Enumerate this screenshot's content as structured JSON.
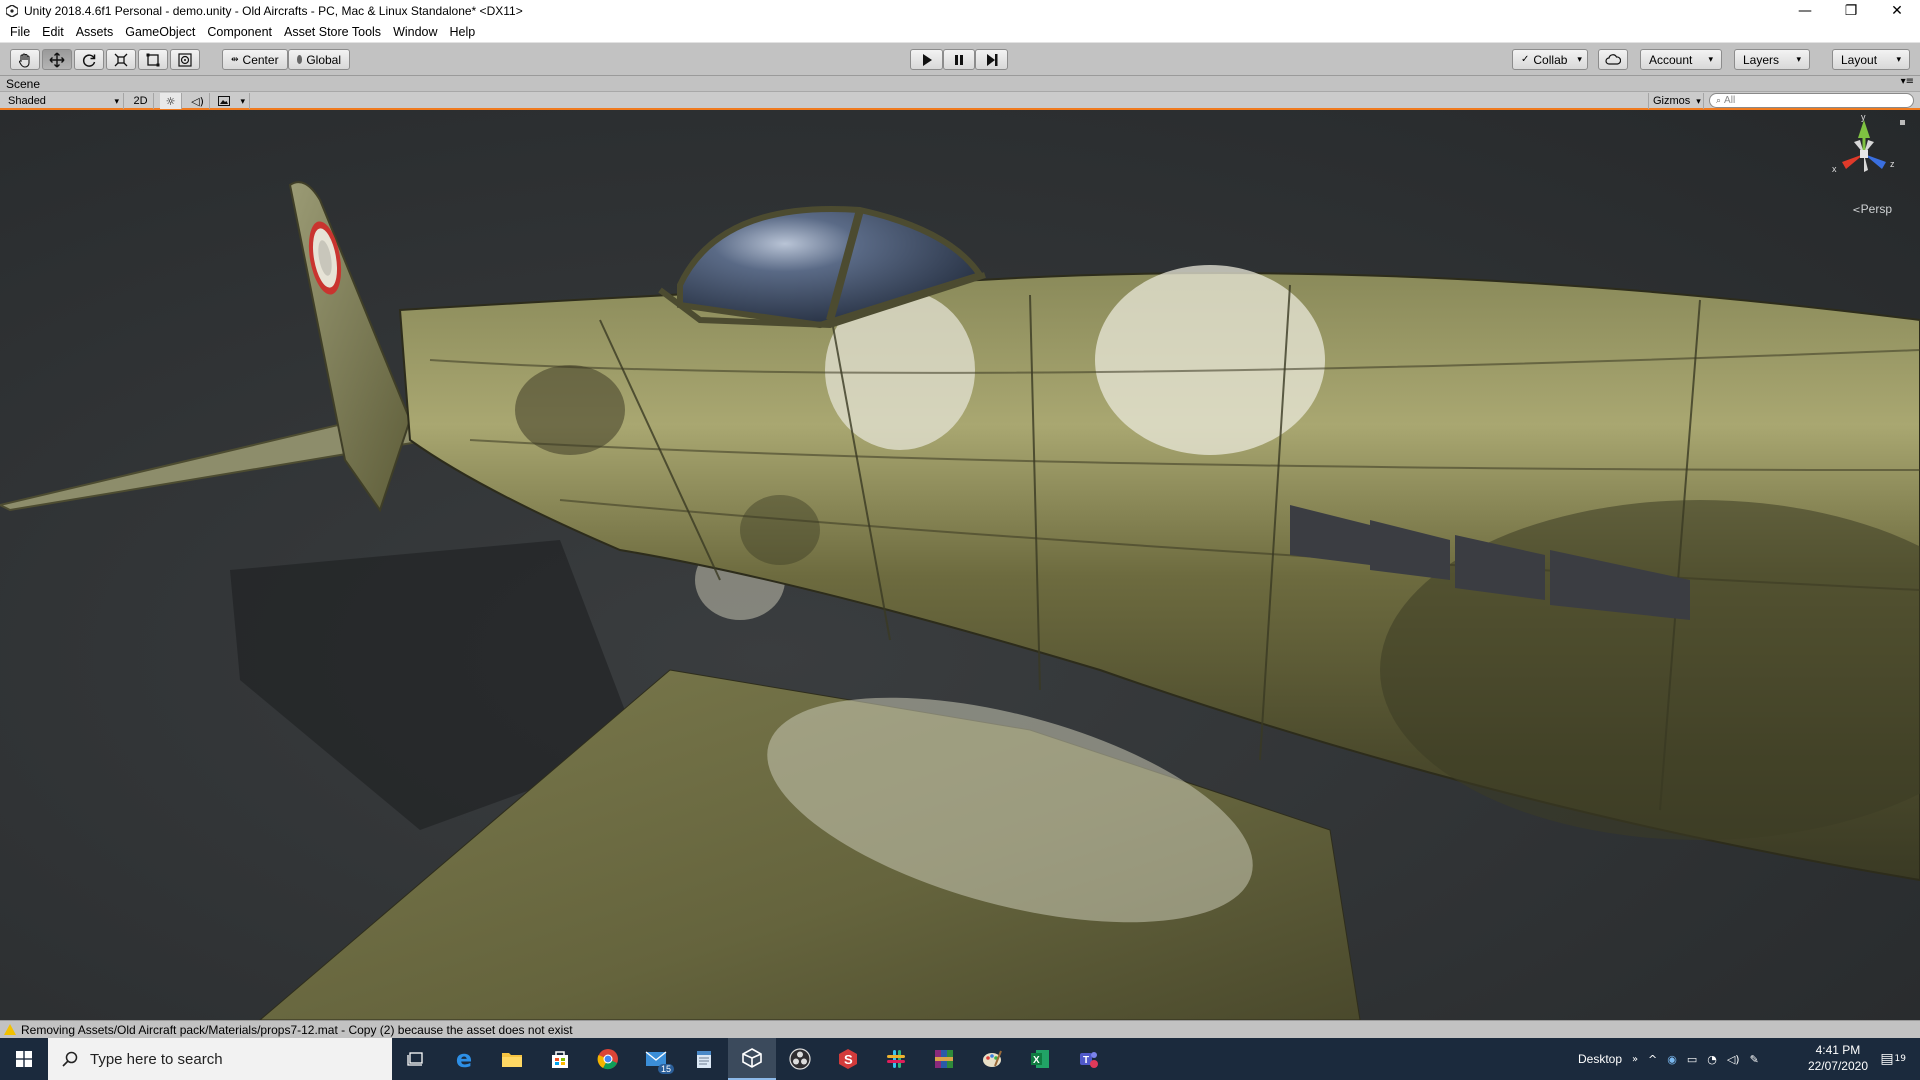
{
  "window": {
    "title": "Unity 2018.4.6f1 Personal - demo.unity - Old Aircrafts - PC, Mac & Linux Standalone* <DX11>",
    "controls": [
      "minimize",
      "restore",
      "close"
    ]
  },
  "menu": [
    "File",
    "Edit",
    "Assets",
    "GameObject",
    "Component",
    "Asset Store Tools",
    "Window",
    "Help"
  ],
  "toolbar": {
    "tools": [
      {
        "name": "hand-tool",
        "icon": "hand-icon",
        "selected": false
      },
      {
        "name": "move-tool",
        "icon": "move-icon",
        "selected": true
      },
      {
        "name": "rotate-tool",
        "icon": "rotate-icon",
        "selected": false
      },
      {
        "name": "scale-tool",
        "icon": "scale-icon",
        "selected": false
      },
      {
        "name": "rect-tool",
        "icon": "rect-icon",
        "selected": false
      },
      {
        "name": "transform-tool",
        "icon": "transform-icon",
        "selected": false
      }
    ],
    "pivot_label": "Center",
    "space_label": "Global",
    "play_icon": "play-icon",
    "pause_icon": "pause-icon",
    "step_icon": "step-icon",
    "collab_label": "Collab",
    "cloud_icon": "cloud-icon",
    "account_label": "Account",
    "layers_label": "Layers",
    "layout_label": "Layout"
  },
  "scene": {
    "tab_label": "Scene",
    "draw_mode": "Shaded",
    "mode_2d": "2D",
    "search_placeholder": "All",
    "gizmos_label": "Gizmos",
    "persp_label": "Persp",
    "gizmo_axes": {
      "y": "y",
      "x": "x",
      "z": "z"
    }
  },
  "console": {
    "message": "Removing Assets/Old Aircraft pack/Materials/props7-12.mat - Copy (2) because the asset does not exist"
  },
  "taskbar": {
    "search_placeholder": "Type here to search",
    "apps": [
      "task-view",
      "edge",
      "file-explorer",
      "store",
      "chrome",
      "mail",
      "notepad",
      "unity",
      "obs",
      "app-s",
      "slack",
      "winrar",
      "paint",
      "excel",
      "teams"
    ],
    "mail_badge": "15",
    "desktop_label": "Desktop",
    "time": "4:41 PM",
    "date": "22/07/2020",
    "notification_count": "19"
  },
  "colors": {
    "accent_orange": "#f07a1e",
    "taskbar": "#1b2a3d",
    "editor_gray": "#c2c2c2"
  }
}
